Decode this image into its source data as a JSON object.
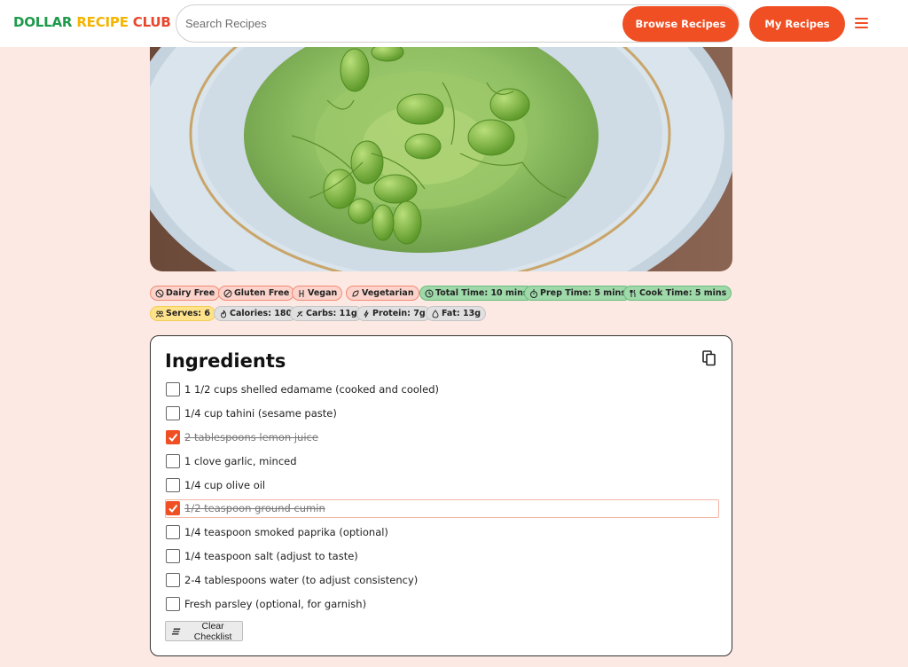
{
  "header": {
    "logo": {
      "word1": "DOLLAR",
      "word2": "RECIPE",
      "word3": "CLUB",
      "colors": {
        "dollar": "#1f9a4c",
        "recipe": "#f4b400",
        "club": "#e8462d"
      }
    },
    "search": {
      "placeholder": "Search Recipes",
      "value": ""
    },
    "browse_label": "Browse Recipes",
    "my_recipes_label": "My Recipes",
    "menu_icon": "hamburger-icon"
  },
  "hero": {
    "subject": "edamame hummus in white bowl",
    "icon": "photo"
  },
  "tags": {
    "row1": [
      {
        "label": "Dairy Free",
        "icon": "no-dairy-icon",
        "kind": "diet"
      },
      {
        "label": "Gluten Free",
        "icon": "no-gluten-icon",
        "kind": "diet"
      },
      {
        "label": "Vegan",
        "icon": "vegan-icon",
        "kind": "diet"
      },
      {
        "label": "Vegetarian",
        "icon": "leaf-icon",
        "kind": "diet"
      },
      {
        "label": "Total Time: 10 mins",
        "icon": "clock-icon",
        "kind": "time"
      },
      {
        "label": "Prep Time: 5 mins",
        "icon": "timer-icon",
        "kind": "time"
      },
      {
        "label": "Cook Time: 5 mins",
        "icon": "utensils-icon",
        "kind": "time"
      }
    ],
    "row2": [
      {
        "label": "Serves: 6",
        "icon": "people-icon",
        "kind": "serve"
      },
      {
        "label": "Calories: 180",
        "icon": "flame-icon",
        "kind": "nut"
      },
      {
        "label": "Carbs: 11g",
        "icon": "grain-icon",
        "kind": "nut"
      },
      {
        "label": "Protein: 7g",
        "icon": "bolt-icon",
        "kind": "nut"
      },
      {
        "label": "Fat: 13g",
        "icon": "drop-icon",
        "kind": "nut"
      }
    ]
  },
  "ingredients": {
    "title": "Ingredients",
    "copy_icon": "copy-icon",
    "items": [
      {
        "text": "1 1/2 cups shelled edamame (cooked and cooled)",
        "checked": false
      },
      {
        "text": "1/4 cup tahini (sesame paste)",
        "checked": false
      },
      {
        "text": "2 tablespoons lemon juice",
        "checked": true
      },
      {
        "text": "1 clove garlic, minced",
        "checked": false
      },
      {
        "text": "1/4 cup olive oil",
        "checked": false
      },
      {
        "text": "1/2 teaspoon ground cumin",
        "checked": true,
        "focused": true
      },
      {
        "text": "1/4 teaspoon smoked paprika (optional)",
        "checked": false
      },
      {
        "text": "1/4 teaspoon salt (adjust to taste)",
        "checked": false
      },
      {
        "text": "2-4 tablespoons water (to adjust consistency)",
        "checked": false
      },
      {
        "text": "Fresh parsley (optional, for garnish)",
        "checked": false
      }
    ],
    "clear_label": "Clear Checklist"
  },
  "colors": {
    "accent": "#f04e23",
    "background": "#fde9e4"
  }
}
